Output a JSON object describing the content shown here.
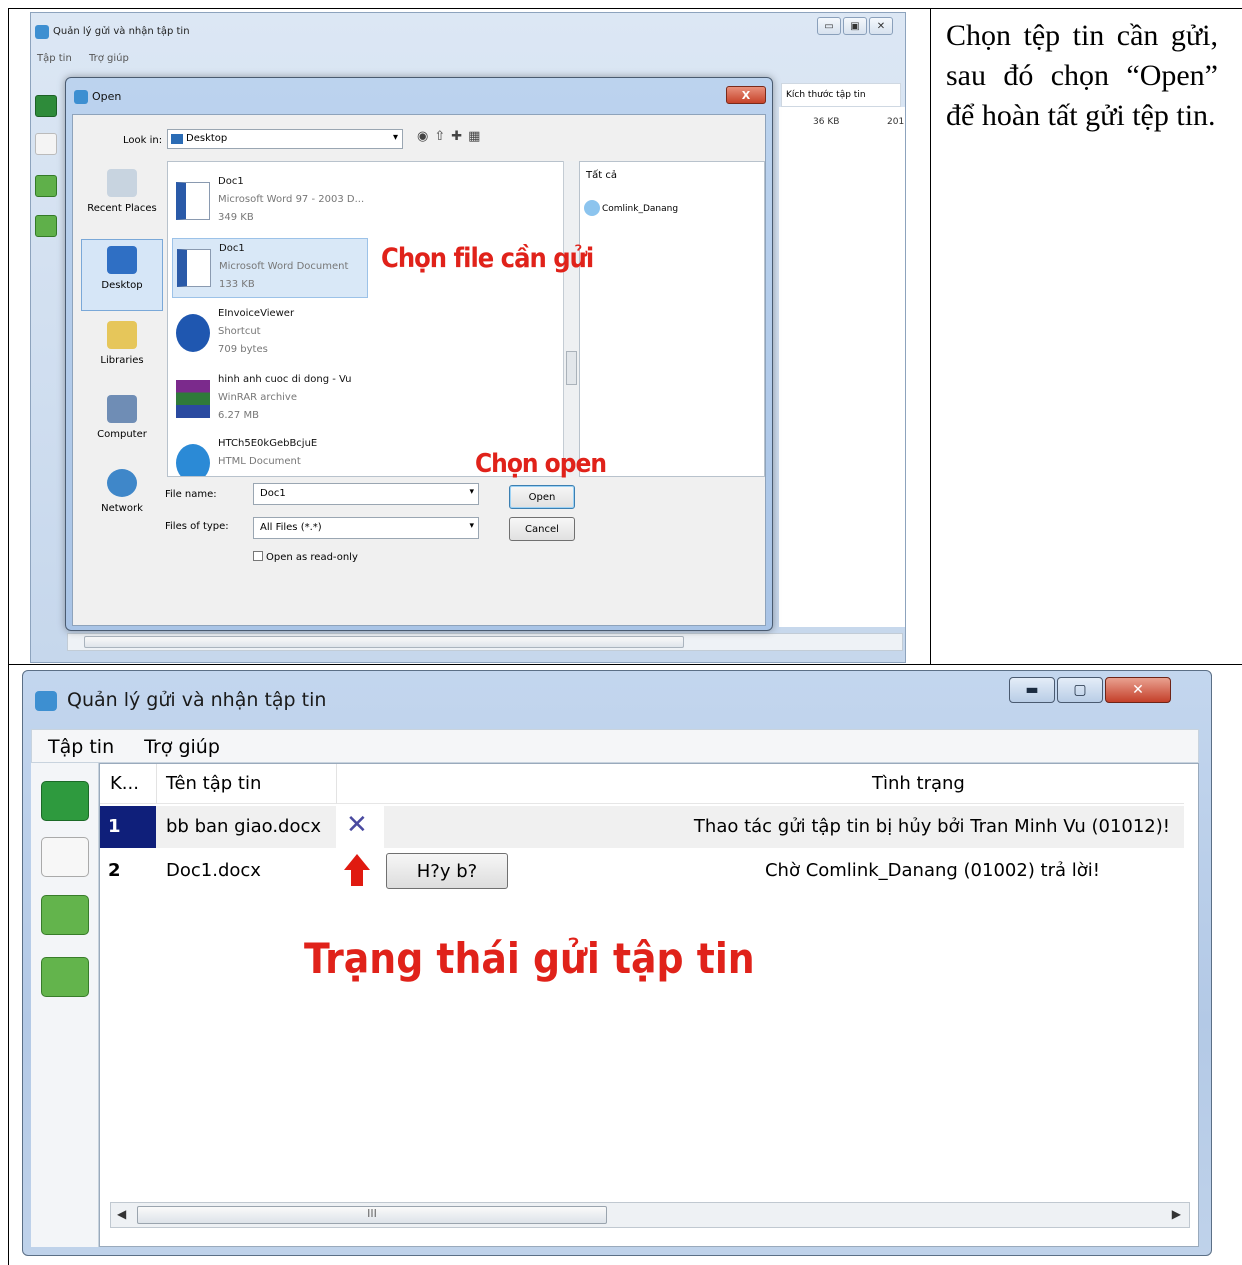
{
  "caption": {
    "text": "Chọn tệp tin cần gửi, sau đó chọn “Open” để hoàn tất gửi tệp tin."
  },
  "top_window": {
    "title": "Quản lý gửi và nhận tập tin",
    "menu": [
      "Tập tin",
      "Trợ giúp"
    ],
    "column_header": "Kích thước tập tin",
    "size_value": "36 KB",
    "size_value2": "201",
    "scroll_thumb": "III"
  },
  "open_dialog": {
    "title": "Open",
    "close": "X",
    "look_in_label": "Look in:",
    "look_in_value": "Desktop",
    "places": [
      "Recent Places",
      "Desktop",
      "Libraries",
      "Computer",
      "Network"
    ],
    "files": [
      {
        "name": "Doc1",
        "type": "Microsoft Word 97 - 2003 D...",
        "size": "349 KB"
      },
      {
        "name": "Doc1",
        "type": "Microsoft Word Document",
        "size": "133 KB"
      },
      {
        "name": "EInvoiceViewer",
        "type": "Shortcut",
        "size": "709 bytes"
      },
      {
        "name": "hinh anh cuoc di dong - Vu",
        "type": "WinRAR archive",
        "size": "6.27 MB"
      },
      {
        "name": "HTCh5E0kGebBcjuE",
        "type": "HTML Document",
        "size": ""
      }
    ],
    "preview_title": "Tất cả",
    "preview_entry": "Comlink_Danang",
    "file_name_label": "File name:",
    "file_name_value": "Doc1",
    "file_type_label": "Files of type:",
    "file_type_value": "All Files (*.*)",
    "open_button": "Open",
    "cancel_button": "Cancel",
    "readonly_label": "Open as read-only"
  },
  "annotations": {
    "choose_file": "Chọn file cần gửi",
    "choose_open": "Chọn open",
    "send_status": "Trạng thái gửi tập tin"
  },
  "bottom_window": {
    "title": "Quản lý gửi và nhận tập tin",
    "menu": [
      "Tập tin",
      "Trợ giúp"
    ],
    "columns": {
      "k": "K...",
      "name": "Tên tập tin",
      "status": "Tình trạng"
    },
    "rows": [
      {
        "num": "1",
        "name": "bb ban giao.docx",
        "status": "Thao tác gửi tập tin bị hủy bởi Tran Minh Vu (01012)!"
      },
      {
        "num": "2",
        "name": "Doc1.docx",
        "button": "H?y b?",
        "status": "Chờ Comlink_Danang (01002) trả lời!"
      }
    ],
    "scroll_thumb": "III",
    "accent_selected": "#0f1f7a",
    "annotation_color": "#e0221a"
  }
}
